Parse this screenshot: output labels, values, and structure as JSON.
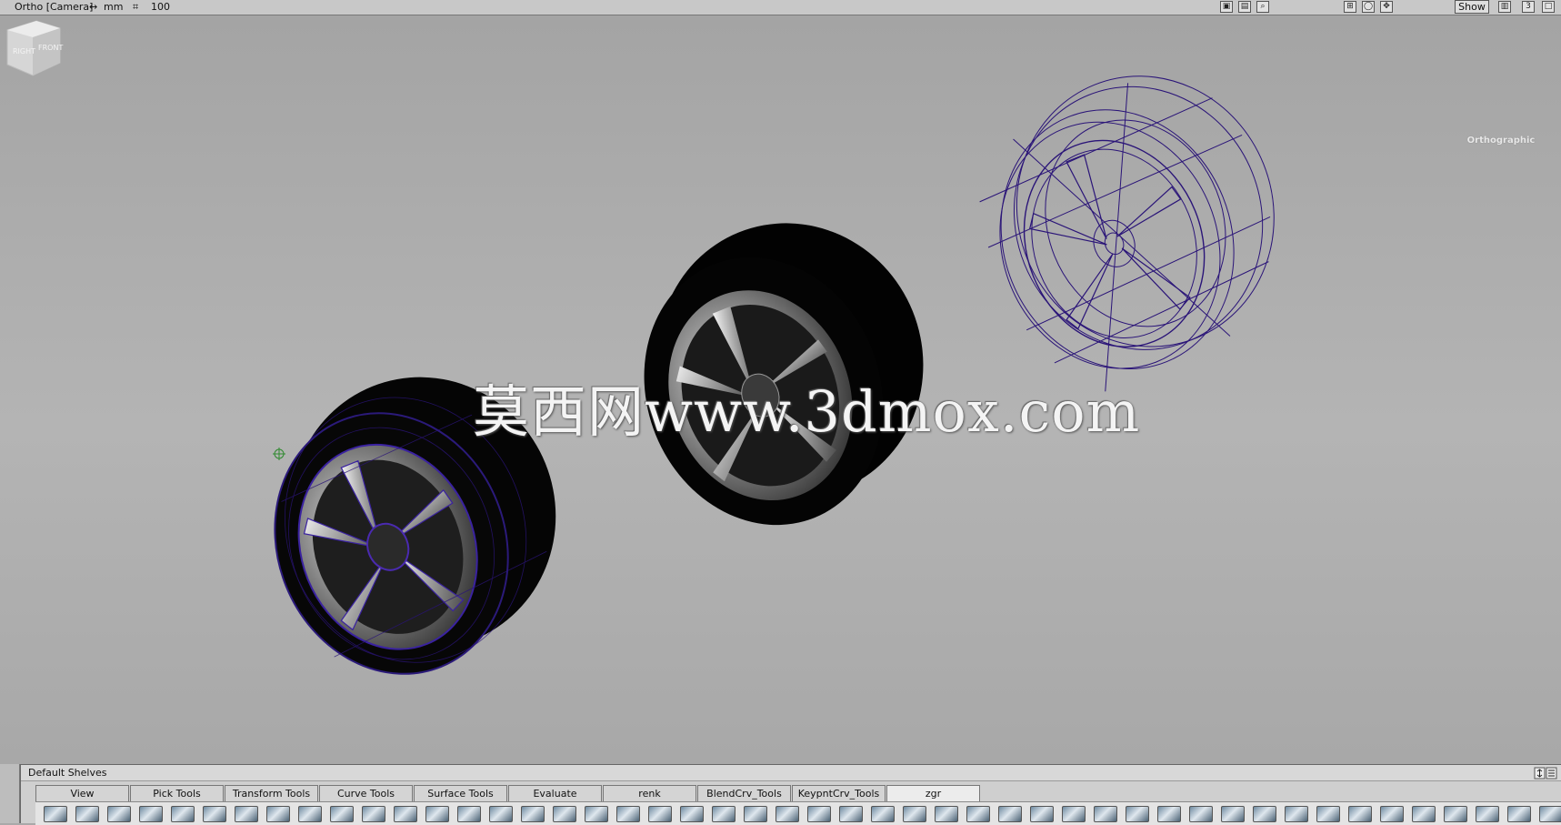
{
  "topbar": {
    "view_label": "Ortho [Camera]",
    "units_label": "mm",
    "grid_value": "100",
    "show_button": "Show",
    "layer_number": "3"
  },
  "viewport": {
    "watermark": "莫西网www.3dmox.com",
    "viewcube_label": "Orthographic",
    "viewcube_faces": [
      "RIGHT",
      "FRONT"
    ],
    "wireframe_color": "#2a1478",
    "tire_color": "#030303",
    "background_color": "#aaaaaa"
  },
  "shelf": {
    "title": "Default Shelves",
    "tabs": [
      {
        "label": "View",
        "active": false
      },
      {
        "label": "Pick Tools",
        "active": false
      },
      {
        "label": "Transform Tools",
        "active": false
      },
      {
        "label": "Curve Tools",
        "active": false
      },
      {
        "label": "Surface Tools",
        "active": false
      },
      {
        "label": "Evaluate",
        "active": false
      },
      {
        "label": "renk",
        "active": false
      },
      {
        "label": "BlendCrv_Tools",
        "active": false
      },
      {
        "label": "KeypntCrv_Tools",
        "active": false
      },
      {
        "label": "zgr",
        "active": true
      }
    ]
  }
}
